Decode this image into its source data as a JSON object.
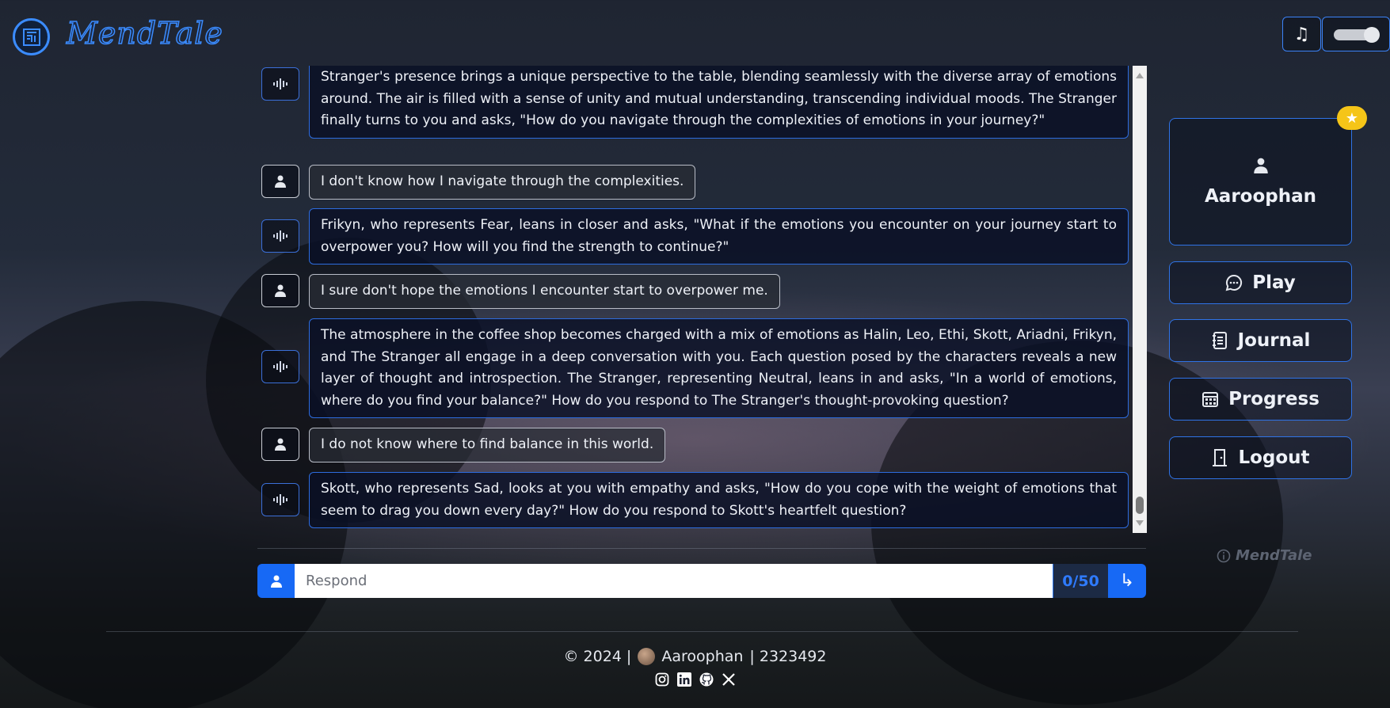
{
  "app": {
    "name": "MendTale"
  },
  "header": {
    "music_icon": "music-note-icon",
    "toggle_state": "on"
  },
  "chat": {
    "messages": [
      {
        "role": "bot",
        "text": "Stranger's presence brings a unique perspective to the table, blending seamlessly with the diverse array of emotions around. The air is filled with a sense of unity and mutual understanding, transcending individual moods. The Stranger finally turns to you and asks, \"How do you navigate through the complexities of emotions in your journey?\""
      },
      {
        "role": "user",
        "text": "I don't know how I navigate through the complexities."
      },
      {
        "role": "bot",
        "text": "Frikyn, who represents Fear, leans in closer and asks, \"What if the emotions you encounter on your journey start to overpower you? How will you find the strength to continue?\""
      },
      {
        "role": "user",
        "text": "I sure don't hope the emotions I encounter start to overpower me."
      },
      {
        "role": "bot",
        "text": "The atmosphere in the coffee shop becomes charged with a mix of emotions as Halin, Leo, Ethi, Skott, Ariadni, Frikyn, and The Stranger all engage in a deep conversation with you. Each question posed by the characters reveals a new layer of thought and introspection. The Stranger, representing Neutral, leans in and asks, \"In a world of emotions, where do you find your balance?\" How do you respond to The Stranger's thought-provoking question?"
      },
      {
        "role": "user",
        "text": "I do not know where to find balance in this world."
      },
      {
        "role": "bot",
        "text": "Skott, who represents Sad, looks at you with empathy and asks, \"How do you cope with the weight of emotions that seem to drag you down every day?\" How do you respond to Skott's heartfelt question?"
      }
    ]
  },
  "input": {
    "placeholder": "Respond",
    "counter": "0/50"
  },
  "sidebar": {
    "profile_name": "Aaroophan",
    "play_label": "Play",
    "journal_label": "Journal",
    "progress_label": "Progress",
    "logout_label": "Logout",
    "watermark": "MendTale"
  },
  "footer": {
    "prefix": "© 2024 |",
    "name": "Aaroophan",
    "id": "| 2323492",
    "socials": [
      "instagram-icon",
      "linkedin-icon",
      "github-icon",
      "x-icon"
    ]
  },
  "colors": {
    "accent": "#1769f5",
    "border": "#2f73e6",
    "star": "#f5c518"
  }
}
